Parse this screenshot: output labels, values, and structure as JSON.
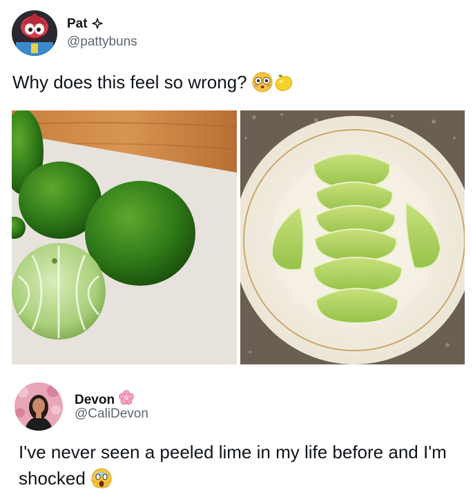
{
  "tweet_original": {
    "author_name": "Pat",
    "author_handle": "@pattybuns",
    "text": "Why does this feel so wrong?",
    "emojis": [
      "flushed-face-icon",
      "lemon-icon"
    ],
    "photos": [
      "peeled-limes-photo",
      "lime-segments-on-plate-photo"
    ]
  },
  "tweet_reply": {
    "author_name": "Devon",
    "author_handle": "@CaliDevon",
    "text": "I've never seen a peeled lime in my life before and I'm shocked",
    "emojis": [
      "screaming-face-icon"
    ]
  },
  "colors": {
    "name_text": "#0f1419",
    "handle_text": "#5b6670",
    "lime_green": "#3f8a1d",
    "pink_badge": "#f06aa6"
  }
}
